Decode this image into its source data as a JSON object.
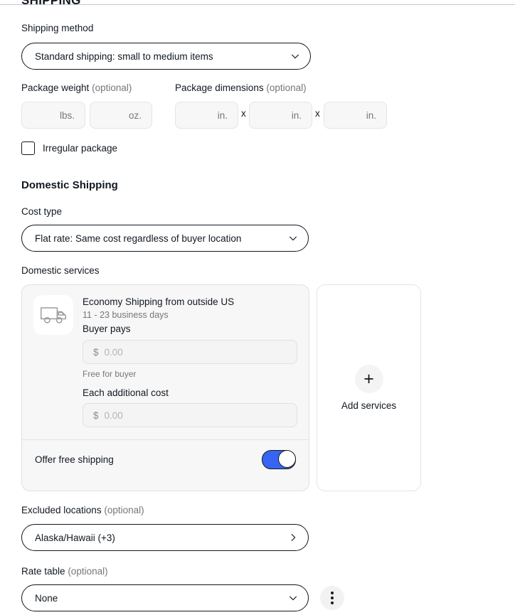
{
  "section": {
    "title": "SHIPPING"
  },
  "shipping_method": {
    "label": "Shipping method",
    "value": "Standard shipping: small to medium items",
    "chevron_icon": "chevron-down-icon"
  },
  "package_weight": {
    "label": "Package weight",
    "optional_suffix": "(optional)",
    "fields": [
      {
        "placeholder": "lbs.",
        "value": ""
      },
      {
        "placeholder": "oz.",
        "value": ""
      }
    ]
  },
  "package_dimensions": {
    "label": "Package dimensions",
    "optional_suffix": "(optional)",
    "separator": "x",
    "fields": [
      {
        "placeholder": "in.",
        "value": ""
      },
      {
        "placeholder": "in.",
        "value": ""
      },
      {
        "placeholder": "in.",
        "value": ""
      }
    ]
  },
  "irregular_package": {
    "label": "Irregular package",
    "checked": false
  },
  "domestic": {
    "heading": "Domestic Shipping",
    "cost_type": {
      "label": "Cost type",
      "value": "Flat rate: Same cost regardless of buyer location",
      "chevron_icon": "chevron-down-icon"
    },
    "services_label": "Domestic services",
    "service_card": {
      "icon": "delivery-truck-icon",
      "name": "Economy Shipping from outside US",
      "delivery_estimate": "11 - 23 business days",
      "buyer_pays_label": "Buyer pays",
      "buyer_pays_currency": "$",
      "buyer_pays_placeholder": "0.00",
      "buyer_pays_value": "",
      "free_note": "Free for buyer",
      "additional_cost_label": "Each additional cost",
      "additional_cost_currency": "$",
      "additional_cost_placeholder": "0.00",
      "additional_cost_value": "",
      "offer_free_shipping_label": "Offer free shipping",
      "offer_free_shipping_on": true
    },
    "add_services": {
      "icon": "plus-icon",
      "plus_glyph": "+",
      "label": "Add services"
    },
    "excluded_locations": {
      "label": "Excluded locations",
      "optional_suffix": "(optional)",
      "value": "Alaska/Hawaii (+3)",
      "chevron_icon": "chevron-right-icon"
    },
    "rate_table": {
      "label": "Rate table",
      "optional_suffix": "(optional)",
      "value": "None",
      "chevron_icon": "chevron-down-icon",
      "overflow_icon": "kebab-menu-icon"
    }
  },
  "colors": {
    "accent_blue": "#3665f3",
    "text_primary": "#111820",
    "text_muted": "#767676",
    "card_bg": "#f7f7f7",
    "border": "#e0e0e0"
  }
}
